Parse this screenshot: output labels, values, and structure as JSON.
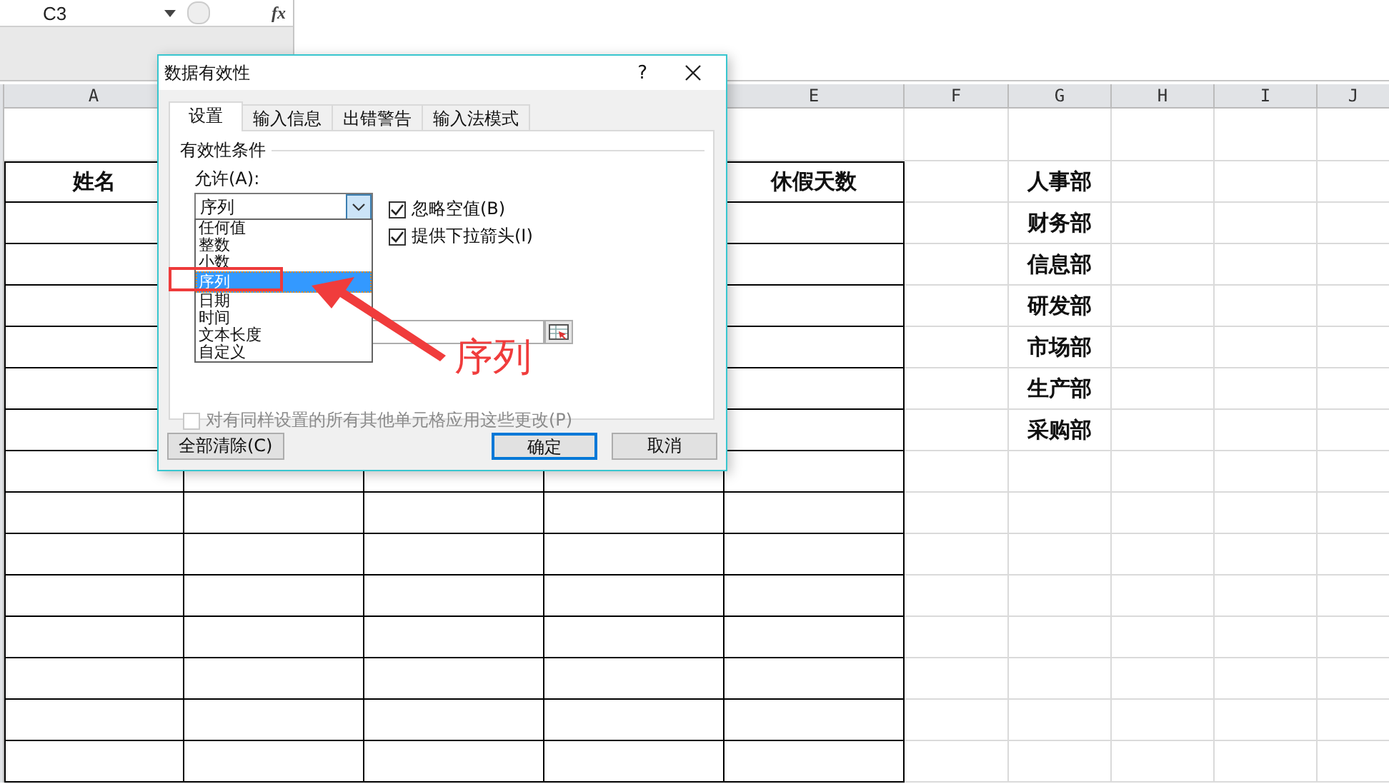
{
  "formula_bar": {
    "name_box": "C3",
    "function_label": "fx"
  },
  "sheet": {
    "columns_left": [
      "A"
    ],
    "columns_right": [
      "E",
      "F",
      "G",
      "H",
      "I",
      "J"
    ],
    "table_header": {
      "first": "姓名",
      "last": "休假天数"
    },
    "departments": [
      "人事部",
      "财务部",
      "信息部",
      "研发部",
      "市场部",
      "生产部",
      "采购部"
    ]
  },
  "dialog": {
    "title": "数据有效性",
    "help": "?",
    "tabs": [
      {
        "label": "设置",
        "selected": true
      },
      {
        "label": "输入信息",
        "selected": false
      },
      {
        "label": "出错警告",
        "selected": false
      },
      {
        "label": "输入法模式",
        "selected": false
      }
    ],
    "group_title": "有效性条件",
    "allow_label": "允许(A):",
    "allow_value": "序列",
    "options": [
      {
        "label": "任何值",
        "selected": false
      },
      {
        "label": "整数",
        "selected": false
      },
      {
        "label": "小数",
        "selected": false
      },
      {
        "label": "序列",
        "selected": true
      },
      {
        "label": "日期",
        "selected": false
      },
      {
        "label": "时间",
        "selected": false
      },
      {
        "label": "文本长度",
        "selected": false
      },
      {
        "label": "自定义",
        "selected": false
      }
    ],
    "checkboxes": [
      {
        "label": "忽略空值(B)",
        "checked": true
      },
      {
        "label": "提供下拉箭头(I)",
        "checked": true
      }
    ],
    "apply_all": {
      "label": "对有同样设置的所有其他单元格应用这些更改(P)",
      "checked": false,
      "disabled": true
    },
    "buttons": [
      {
        "label": "全部清除(C)",
        "kind": "plain"
      },
      {
        "label": "确定",
        "kind": "default"
      },
      {
        "label": "取消",
        "kind": "plain"
      }
    ]
  },
  "annotation": {
    "label": "序列"
  }
}
